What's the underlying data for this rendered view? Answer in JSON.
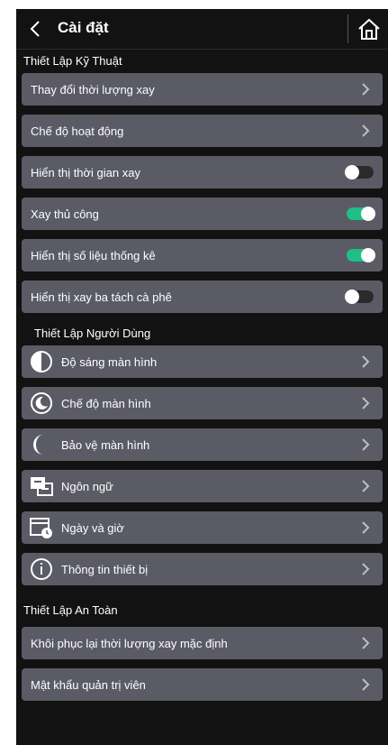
{
  "header": {
    "title": "Cài đặt"
  },
  "sections": [
    {
      "title": "Thiết Lập Kỹ Thuật"
    },
    {
      "title": "Thiết Lập Người Dùng"
    },
    {
      "title": "Thiết Lập An Toàn"
    }
  ],
  "technical": [
    {
      "label": "Thay đổi thời lượng xay",
      "control": "chevron"
    },
    {
      "label": "Chế độ hoạt động",
      "control": "chevron"
    },
    {
      "label": "Hiển thị thời gian xay",
      "control": "toggle",
      "state": "off"
    },
    {
      "label": "Xay thủ công",
      "control": "toggle",
      "state": "on"
    },
    {
      "label": "Hiển thị số liệu thống kê",
      "control": "toggle",
      "state": "on"
    },
    {
      "label": "Hiển thị xay ba tách cà phê",
      "control": "toggle",
      "state": "off"
    }
  ],
  "user": [
    {
      "label": "Độ sáng màn hình",
      "icon": "brightness-icon"
    },
    {
      "label": "Chế độ màn hình",
      "icon": "display-mode-icon"
    },
    {
      "label": "Bảo vệ màn hình",
      "icon": "screensaver-icon"
    },
    {
      "label": "Ngôn ngữ",
      "icon": "language-icon"
    },
    {
      "label": "Ngày và giờ",
      "icon": "calendar-clock-icon"
    },
    {
      "label": "Thông tin thiết bị",
      "icon": "info-icon"
    }
  ],
  "safety": [
    {
      "label": "Khôi phục lại thời lượng xay mặc định"
    },
    {
      "label": "Mật khẩu quản trị viên"
    }
  ],
  "colors": {
    "background": "#121212",
    "row": "#5b5b66",
    "toggle_on": "#1fbf86",
    "toggle_off": "#2b2b2b"
  }
}
